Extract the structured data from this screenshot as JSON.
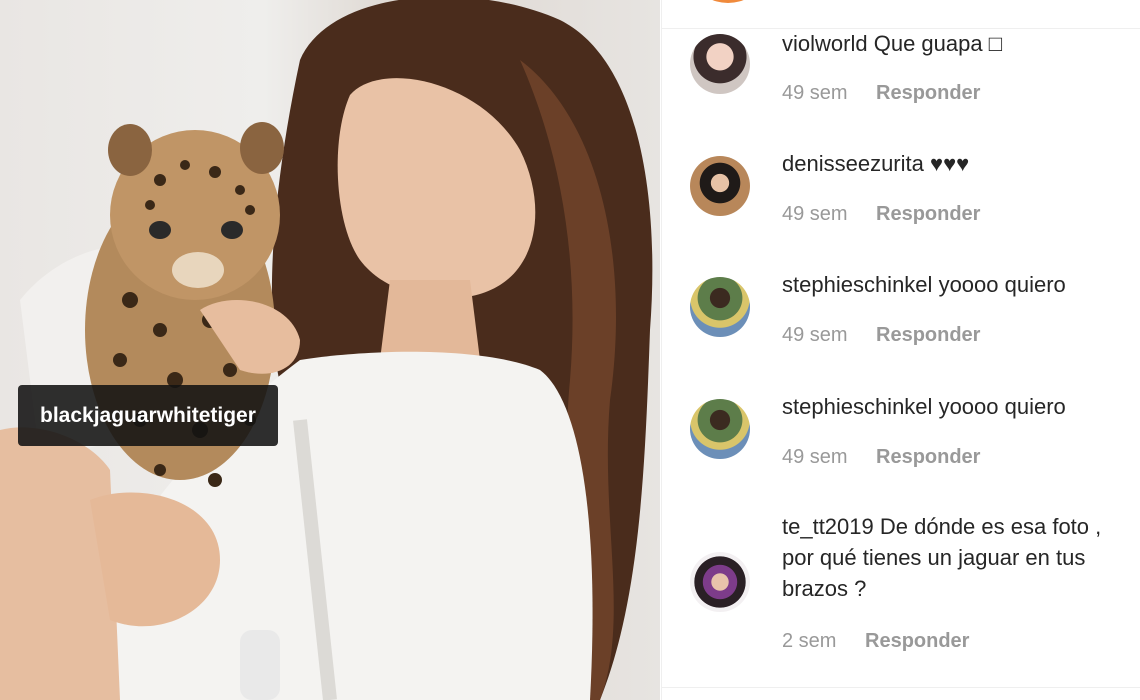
{
  "photo": {
    "tag_label": "blackjaguarwhitetiger"
  },
  "comments": [
    {
      "username": "violworld",
      "text": "Que guapa □",
      "time": "49 sem",
      "reply_label": "Responder"
    },
    {
      "username": "denisseezurita",
      "text": "♥♥♥",
      "time": "49 sem",
      "reply_label": "Responder"
    },
    {
      "username": "stephieschinkel",
      "text": "yoooo quiero",
      "time": "49 sem",
      "reply_label": "Responder"
    },
    {
      "username": "stephieschinkel",
      "text": "yoooo quiero",
      "time": "49 sem",
      "reply_label": "Responder"
    },
    {
      "username": "te_tt2019",
      "text": "De dónde es esa foto , por qué tienes un jaguar en tus brazos ?",
      "time": "2 sem",
      "reply_label": "Responder"
    }
  ]
}
